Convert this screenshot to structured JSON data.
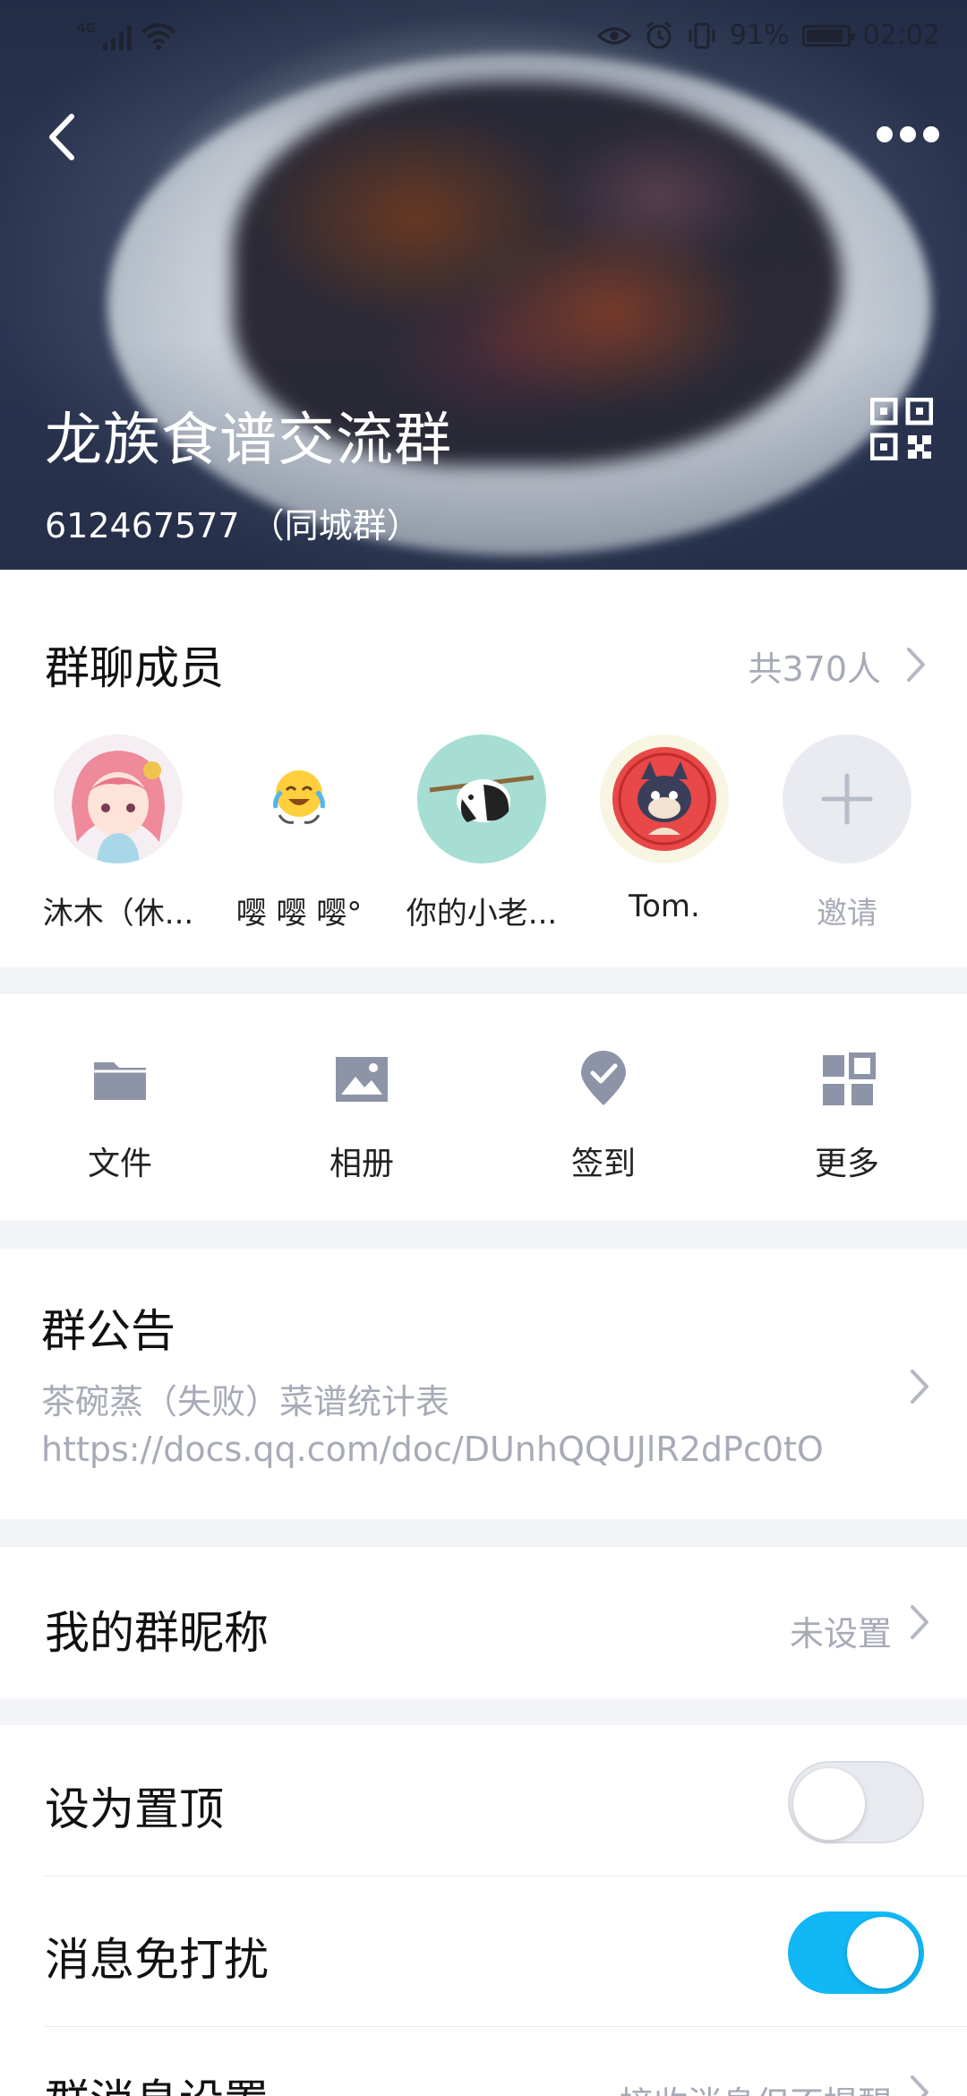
{
  "status_bar": {
    "signal_label": "4G",
    "battery_text": "91%",
    "battery_level": 0.91,
    "time": "02:02"
  },
  "header": {
    "group_name": "龙族食谱交流群",
    "group_id_line": "612467577 （同城群）"
  },
  "members": {
    "title": "群聊成员",
    "count_text": "共370人",
    "items": [
      {
        "name": "沐木（休..."
      },
      {
        "name": "嘤 嘤 嘤°"
      },
      {
        "name": "你的小老..."
      },
      {
        "name": "Tom."
      }
    ],
    "invite_label": "邀请"
  },
  "tools": {
    "items": [
      {
        "label": "文件",
        "icon": "folder-icon"
      },
      {
        "label": "相册",
        "icon": "image-icon"
      },
      {
        "label": "签到",
        "icon": "checkin-pin-icon"
      },
      {
        "label": "更多",
        "icon": "grid-more-icon"
      }
    ]
  },
  "notice": {
    "title": "群公告",
    "line1": "茶碗蒸（失败）菜谱统计表",
    "line2": "https://docs.qq.com/doc/DUnhQQUJlR2dPc0tO"
  },
  "nickname": {
    "label": "我的群昵称",
    "value": "未设置"
  },
  "settings": {
    "pin_label": "设为置顶",
    "pin_on": false,
    "dnd_label": "消息免打扰",
    "dnd_on": true,
    "msg_label": "群消息设置",
    "msg_value": "接收消息但不提醒"
  },
  "colors": {
    "accent": "#12b7f5",
    "icon_gray": "#8e94a8",
    "muted_text": "#a7abb7"
  }
}
